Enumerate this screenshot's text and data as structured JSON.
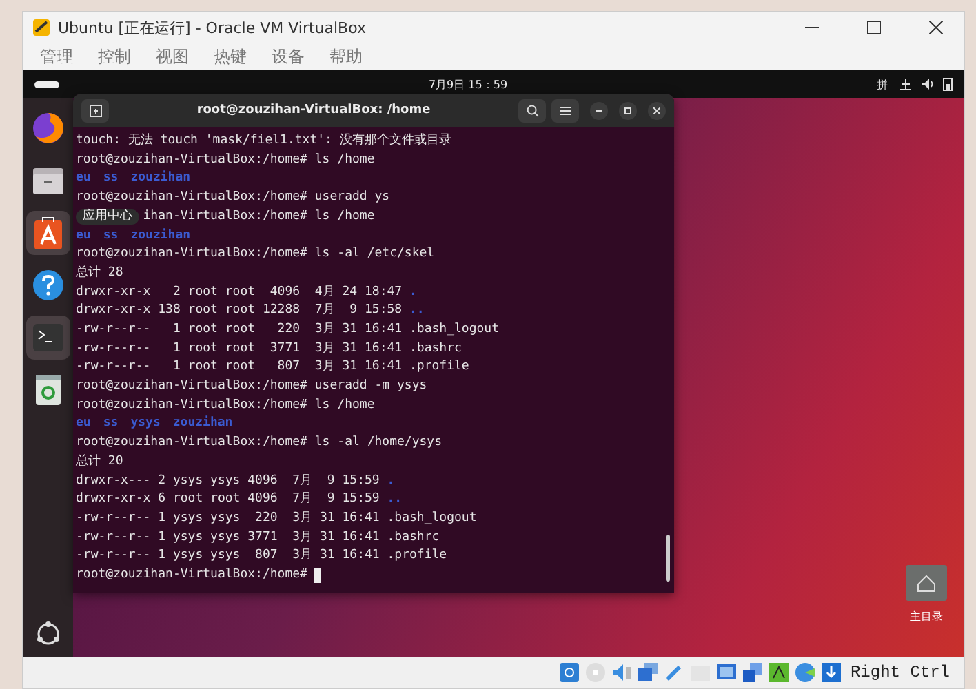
{
  "window": {
    "title": "Ubuntu [正在运行] - Oracle VM VirtualBox"
  },
  "menu": [
    "管理",
    "控制",
    "视图",
    "热键",
    "设备",
    "帮助"
  ],
  "top_bar": {
    "clock": "7月9日 15：59",
    "input_method": "拼"
  },
  "dock": {
    "tooltip": "应用中心"
  },
  "terminal": {
    "title": "root@zouzihan-VirtualBox: /home",
    "lines": [
      {
        "kind": "text",
        "text": "touch: 无法 touch 'mask/fiel1.txt': 没有那个文件或目录"
      },
      {
        "kind": "text",
        "text": "root@zouzihan-VirtualBox:/home# ls /home"
      },
      {
        "kind": "dirs",
        "items": [
          "eu",
          "ss",
          "zouzihan"
        ]
      },
      {
        "kind": "text",
        "text": "root@zouzihan-VirtualBox:/home# useradd ys"
      },
      {
        "kind": "covered",
        "text": "ihan-VirtualBox:/home# ls /home"
      },
      {
        "kind": "dirs",
        "items": [
          "eu",
          "ss",
          "zouzihan"
        ]
      },
      {
        "kind": "text",
        "text": "root@zouzihan-VirtualBox:/home# ls -al /etc/skel"
      },
      {
        "kind": "text",
        "text": "总计 28"
      },
      {
        "kind": "entry",
        "text": "drwxr-xr-x   2 root root  4096  4月 24 18:47",
        "name": ".",
        "is_dir": true
      },
      {
        "kind": "entry",
        "text": "drwxr-xr-x 138 root root 12288  7月  9 15:58",
        "name": "..",
        "is_dir": true
      },
      {
        "kind": "entry",
        "text": "-rw-r--r--   1 root root   220  3月 31 16:41",
        "name": ".bash_logout",
        "is_dir": false
      },
      {
        "kind": "entry",
        "text": "-rw-r--r--   1 root root  3771  3月 31 16:41",
        "name": ".bashrc",
        "is_dir": false
      },
      {
        "kind": "entry",
        "text": "-rw-r--r--   1 root root   807  3月 31 16:41",
        "name": ".profile",
        "is_dir": false
      },
      {
        "kind": "text",
        "text": "root@zouzihan-VirtualBox:/home# useradd -m ysys"
      },
      {
        "kind": "text",
        "text": "root@zouzihan-VirtualBox:/home# ls /home"
      },
      {
        "kind": "dirs",
        "items": [
          "eu",
          "ss",
          "ysys",
          "zouzihan"
        ]
      },
      {
        "kind": "text",
        "text": "root@zouzihan-VirtualBox:/home# ls -al /home/ysys"
      },
      {
        "kind": "text",
        "text": "总计 20"
      },
      {
        "kind": "entry",
        "text": "drwxr-x--- 2 ysys ysys 4096  7月  9 15:59",
        "name": ".",
        "is_dir": true
      },
      {
        "kind": "entry",
        "text": "drwxr-xr-x 6 root root 4096  7月  9 15:59",
        "name": "..",
        "is_dir": true
      },
      {
        "kind": "entry",
        "text": "-rw-r--r-- 1 ysys ysys  220  3月 31 16:41",
        "name": ".bash_logout",
        "is_dir": false
      },
      {
        "kind": "entry",
        "text": "-rw-r--r-- 1 ysys ysys 3771  3月 31 16:41",
        "name": ".bashrc",
        "is_dir": false
      },
      {
        "kind": "entry",
        "text": "-rw-r--r-- 1 ysys ysys  807  3月 31 16:41",
        "name": ".profile",
        "is_dir": false
      },
      {
        "kind": "prompt",
        "text": "root@zouzihan-VirtualBox:/home#"
      }
    ]
  },
  "desktop_icon": {
    "label": "主目录"
  },
  "status_bar": {
    "host_key": "Right Ctrl"
  }
}
